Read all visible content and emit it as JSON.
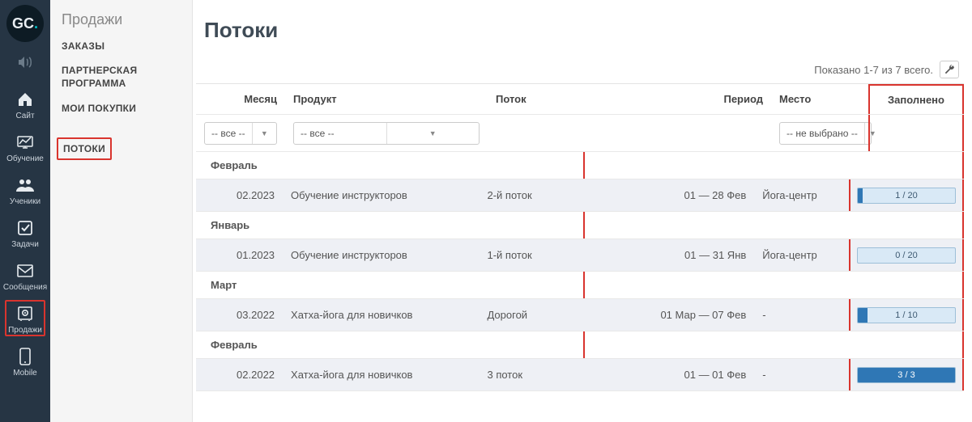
{
  "logo": {
    "text": "GC",
    "dot": "."
  },
  "rail": [
    {
      "id": "sound",
      "label": ""
    },
    {
      "id": "site",
      "label": "Сайт"
    },
    {
      "id": "learn",
      "label": "Обучение"
    },
    {
      "id": "students",
      "label": "Ученики"
    },
    {
      "id": "tasks",
      "label": "Задачи"
    },
    {
      "id": "messages",
      "label": "Сообщения"
    },
    {
      "id": "sales",
      "label": "Продажи",
      "selected": true
    },
    {
      "id": "mobile",
      "label": "Mobile"
    }
  ],
  "subnav": {
    "title": "Продажи",
    "items": [
      {
        "label": "ЗАКАЗЫ"
      },
      {
        "label": "ПАРТНЕРСКАЯ ПРОГРАММА"
      },
      {
        "label": "МОИ ПОКУПКИ"
      },
      {
        "label": "ПОТОКИ",
        "active": true
      }
    ]
  },
  "page": {
    "title": "Потоки",
    "summary": "Показано 1-7 из 7 всего."
  },
  "columns": {
    "month": "Месяц",
    "product": "Продукт",
    "stream": "Поток",
    "period": "Период",
    "place": "Место",
    "fill": "Заполнено"
  },
  "filters": {
    "month": "-- все --",
    "product": "-- все --",
    "place": "-- не выбрано --"
  },
  "groups": [
    {
      "name": "Февраль",
      "rows": [
        {
          "month": "02.2023",
          "product": "Обучение инструкторов",
          "stream": "2-й поток",
          "period": "01 — 28 Фев",
          "place": "Йога-центр",
          "done": 1,
          "total": 20
        }
      ]
    },
    {
      "name": "Январь",
      "rows": [
        {
          "month": "01.2023",
          "product": "Обучение инструкторов",
          "stream": "1-й поток",
          "period": "01 — 31 Янв",
          "place": "Йога-центр",
          "done": 0,
          "total": 20
        }
      ]
    },
    {
      "name": "Март",
      "rows": [
        {
          "month": "03.2022",
          "product": "Хатха-йога для новичков",
          "stream": "Дорогой",
          "period": "01 Мар — 07 Фев",
          "place": "-",
          "done": 1,
          "total": 10
        }
      ]
    },
    {
      "name": "Февраль",
      "rows": [
        {
          "month": "02.2022",
          "product": "Хатха-йога для новичков",
          "stream": "3 поток",
          "period": "01 — 01 Фев",
          "place": "-",
          "done": 3,
          "total": 3
        }
      ]
    }
  ]
}
